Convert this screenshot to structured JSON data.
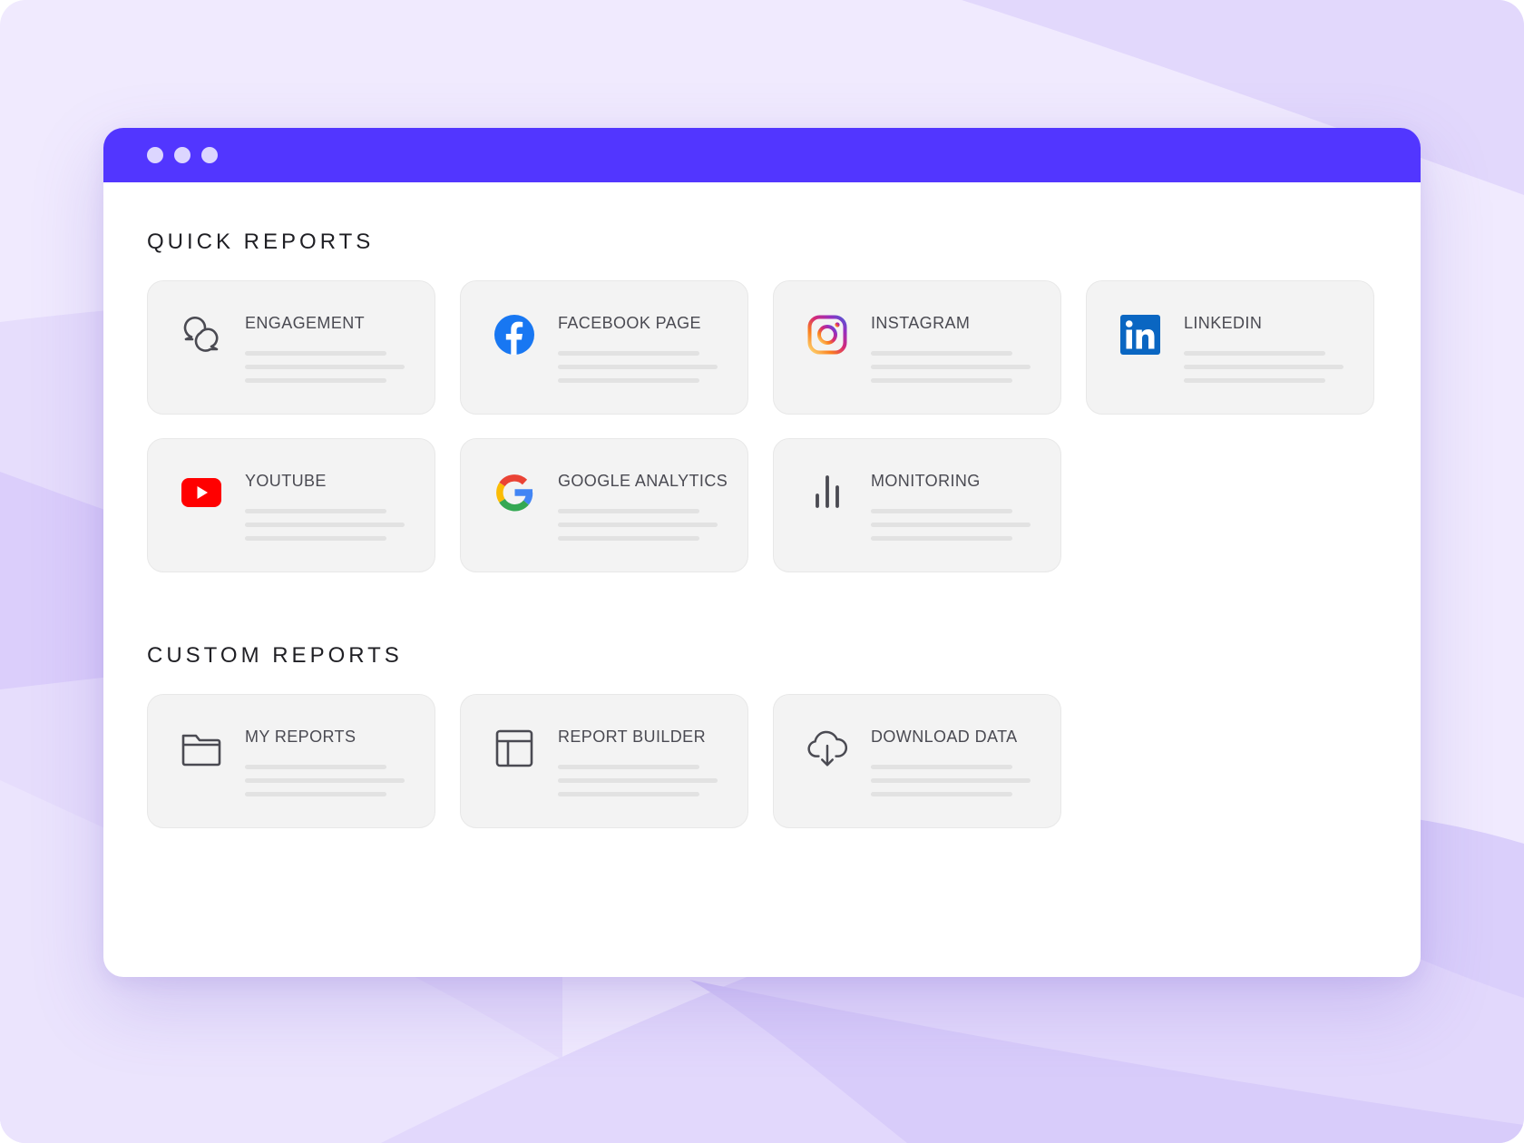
{
  "colors": {
    "accent": "#5236ff",
    "window_dot": "#dcd6ff",
    "card_bg": "#f3f3f3",
    "facebook": "#1877f2",
    "linkedin": "#0a66c2",
    "youtube": "#ff0000"
  },
  "quick_reports": {
    "title": "QUICK REPORTS",
    "cards": [
      {
        "label": "ENGAGEMENT",
        "icon": "chat-bubbles-icon"
      },
      {
        "label": "FACEBOOK PAGE",
        "icon": "facebook-icon"
      },
      {
        "label": "INSTAGRAM",
        "icon": "instagram-icon"
      },
      {
        "label": "LINKEDIN",
        "icon": "linkedin-icon"
      },
      {
        "label": "YOUTUBE",
        "icon": "youtube-icon"
      },
      {
        "label": "GOOGLE ANALYTICS",
        "icon": "google-icon"
      },
      {
        "label": "MONITORING",
        "icon": "bar-chart-icon"
      }
    ]
  },
  "custom_reports": {
    "title": "CUSTOM REPORTS",
    "cards": [
      {
        "label": "MY REPORTS",
        "icon": "folder-icon"
      },
      {
        "label": "REPORT BUILDER",
        "icon": "layout-icon"
      },
      {
        "label": "DOWNLOAD DATA",
        "icon": "cloud-download-icon"
      }
    ]
  }
}
